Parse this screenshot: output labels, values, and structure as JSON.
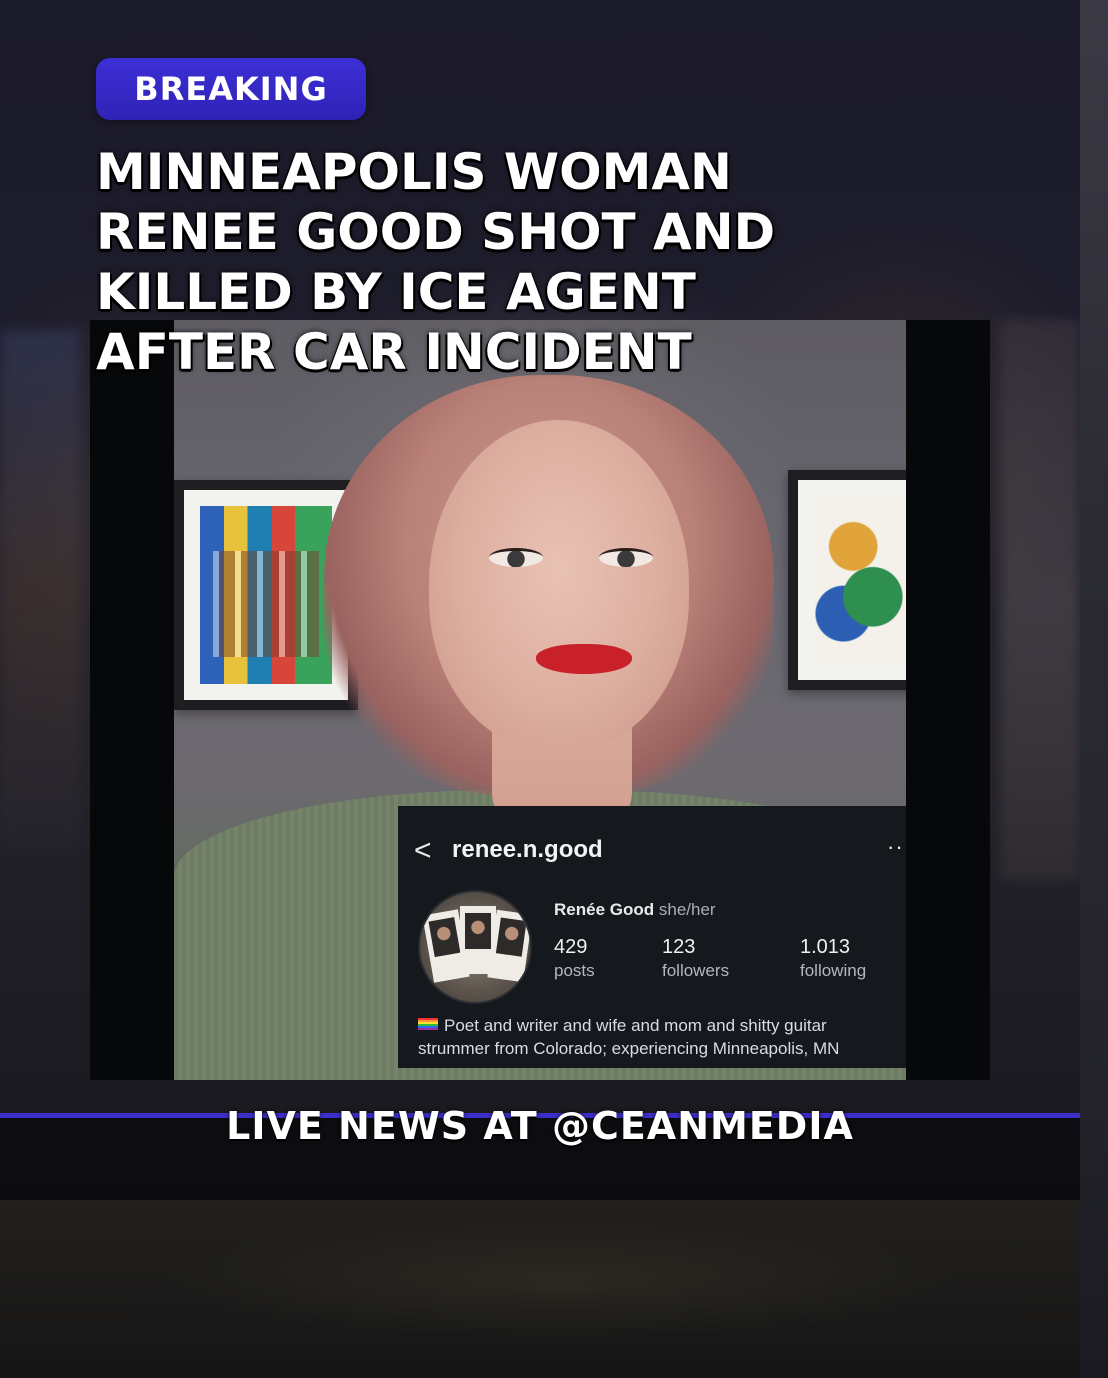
{
  "badge": {
    "label": "BREAKING",
    "color": "#3a2cd0"
  },
  "headline": {
    "lines": [
      "MINNEAPOLIS WOMAN",
      "RENEE GOOD SHOT AND",
      "KILLED BY ICE AGENT",
      "AFTER CAR INCIDENT"
    ]
  },
  "profile": {
    "back_icon": "chevron-left-icon",
    "username": "renee.n.good",
    "more_icon": "more-horizontal-icon",
    "more_glyph": "···",
    "back_glyph": "<",
    "name": "Renée Good",
    "pronouns": "she/her",
    "stats": [
      {
        "value": "429",
        "label": "posts"
      },
      {
        "value": "123",
        "label": "followers"
      },
      {
        "value": "1.013",
        "label": "following"
      }
    ],
    "bio_flag_icon": "rainbow-flag-icon",
    "bio_line1": "Poet and writer and wife and mom and shitty guitar",
    "bio_line2": "strummer from Colorado; experiencing Minneapolis, MN"
  },
  "footer": {
    "label": "LIVE NEWS AT @CEANMEDIA",
    "accent": "#3c2ec9"
  }
}
